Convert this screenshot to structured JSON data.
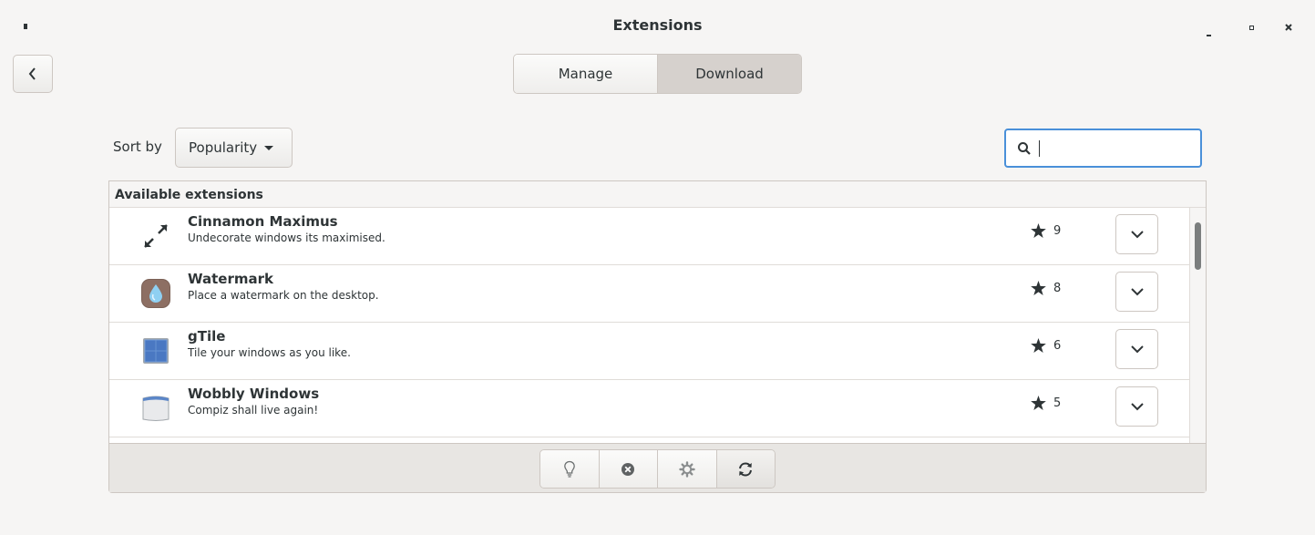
{
  "window": {
    "title": "Extensions",
    "controls": {
      "minimize": "-",
      "maximize": "□",
      "close": "×"
    }
  },
  "tabs": [
    {
      "label": "Manage",
      "selected": false
    },
    {
      "label": "Download",
      "selected": true
    }
  ],
  "sort": {
    "label": "Sort by",
    "value": "Popularity"
  },
  "search": {
    "value": "",
    "placeholder": ""
  },
  "list": {
    "header": "Available extensions",
    "items": [
      {
        "name": "Cinnamon Maximus",
        "description": "Undecorate windows its maximised.",
        "rating": "9",
        "icon": "maximize-arrows-icon"
      },
      {
        "name": "Watermark",
        "description": "Place a watermark on the desktop.",
        "rating": "8",
        "icon": "water-drop-icon"
      },
      {
        "name": "gTile",
        "description": "Tile your windows as you like.",
        "rating": "6",
        "icon": "tile-grid-icon"
      },
      {
        "name": "Wobbly Windows",
        "description": "Compiz shall live again!",
        "rating": "5",
        "icon": "window-icon"
      }
    ]
  },
  "toolbar": {
    "buttons": [
      "info-lightbulb-icon",
      "remove-icon",
      "settings-gear-icon",
      "refresh-icon"
    ]
  },
  "colors": {
    "accent": "#4a90d9",
    "selected_tab": "#d6d1cd",
    "background": "#f6f5f4"
  }
}
